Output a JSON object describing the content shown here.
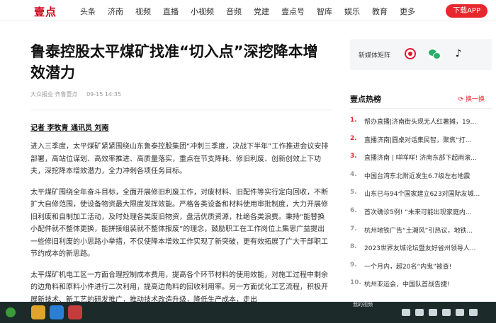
{
  "nav": {
    "logo": "壹点",
    "items": [
      "头条",
      "济南",
      "视频",
      "直播",
      "小视频",
      "音频",
      "党建",
      "壹点号",
      "智库",
      "娱乐",
      "教育",
      "更多"
    ],
    "download": "下载APP"
  },
  "article": {
    "title": "鲁泰控股太平煤矿找准“切入点”深挖降本增效潜力",
    "source": "大众报业·齐鲁壹点",
    "date": "09-15 14:35",
    "byline": "记者 李牧青 通讯员 刘南",
    "paragraphs": [
      "进入三季度，太平煤矿紧紧围绕山东鲁泰控股集团“冲刺三季度，决战下半年”工作推进会议安排部署，高站位谋划、高效率推进、高质量落实，重点在节支降耗、修旧利废、创新创效上下功夫，深挖降本增效潜力，全力冲刺各项任务目标。",
      "太平煤矿围绕全年奋斗目标，全面开展修旧利废工作，对废材料、旧配件等实行定向回收，不断扩大自修范围，使设备物资最大限度发挥效能。严格各类设备和材料使用审批制度，大力开展修旧利废和自制加工活动，及时处理各类废旧物资，盘活优质资源，杜绝各类浪费。秉持“能替换小配件就不整体更换，能拼接组装就不整体报废”的理念，鼓励职工在工作岗位上集思广益提出一些修旧利废的小思路小举措，不仅使降本增效工作实现了新突破，更有效拓展了广大干部职工节约成本的新思路。",
      "太平煤矿机电工区一方面合理控制成本费用，提高各个环节材料的使用效能，对施工过程中剩余的边角料和原料小件进行二次利用，提高边角料的回收利用率。另一方面优化工艺流程，积极开展新技术、新工艺的研发推广，推动技术改造升级，降低生产成本，走出"
    ]
  },
  "sidebar": {
    "media_label": "新媒体矩阵",
    "hot_title": "壹点热榜",
    "refresh": "换一换",
    "hot_items": [
      {
        "num": "1.",
        "text": "帮办直播|济南街头现无人红薯摊，19..."
      },
      {
        "num": "2.",
        "text": "直播济南|圆桌对话集民智，聚焦“打..."
      },
      {
        "num": "3.",
        "text": "直播济南 | 咩咩咩! 济南东部下起雨滚..."
      },
      {
        "num": "4.",
        "text": "中国台湾东北附近发生6.7级左右地震"
      },
      {
        "num": "5.",
        "text": "山东已与94个国家建立623对国际友城..."
      },
      {
        "num": "6.",
        "text": "首次确诊5例! “未来可能出现家庭内..."
      },
      {
        "num": "7.",
        "text": "杭州地铁广告“土潮风”引热议，地铁..."
      },
      {
        "num": "8.",
        "text": "2023世界友城论坛暨友好省州领导人..."
      },
      {
        "num": "9.",
        "text": "一个月内，超20名“内鬼”被查!"
      },
      {
        "num": "10.",
        "text": "杭州亚运会，中国队首战告捷!"
      }
    ]
  },
  "taskbar": {
    "status": "我的视频"
  }
}
